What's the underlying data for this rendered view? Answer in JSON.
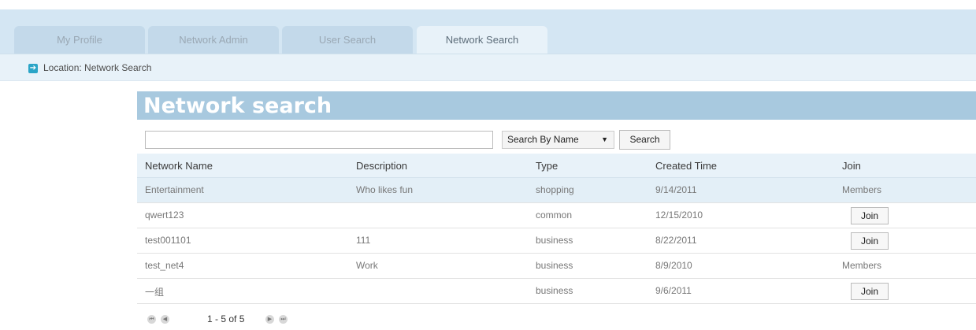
{
  "tabs": [
    {
      "label": "My Profile"
    },
    {
      "label": "Network Admin"
    },
    {
      "label": "User Search"
    },
    {
      "label": "Network Search"
    }
  ],
  "location": {
    "text": "Location:  Network Search",
    "icon": "arrow-right-icon"
  },
  "panel": {
    "title": "Network search"
  },
  "search": {
    "value": "",
    "placeholder": "",
    "select_value": "Search By Name",
    "button_label": "Search"
  },
  "table": {
    "columns": [
      "Network Name",
      "Description",
      "Type",
      "Created Time",
      "Join"
    ],
    "rows": [
      {
        "name": "Entertainment",
        "description": "Who likes fun",
        "type": "shopping",
        "created": "9/14/2011",
        "join": "Members"
      },
      {
        "name": "qwert123",
        "description": "",
        "type": "common",
        "created": "12/15/2010",
        "join": "Join"
      },
      {
        "name": "test001101",
        "description": "111",
        "type": "business",
        "created": "8/22/2011",
        "join": "Join"
      },
      {
        "name": "test_net4",
        "description": "Work",
        "type": "business",
        "created": "8/9/2010",
        "join": "Members"
      },
      {
        "name": "一组",
        "description": "",
        "type": "business",
        "created": "9/6/2011",
        "join": "Join"
      }
    ]
  },
  "pager": {
    "text": "1 - 5 of 5"
  },
  "colors": {
    "tabbar": "#d4e6f3",
    "panel_header": "#a8c9df",
    "highlight_row": "#e3eff7"
  }
}
